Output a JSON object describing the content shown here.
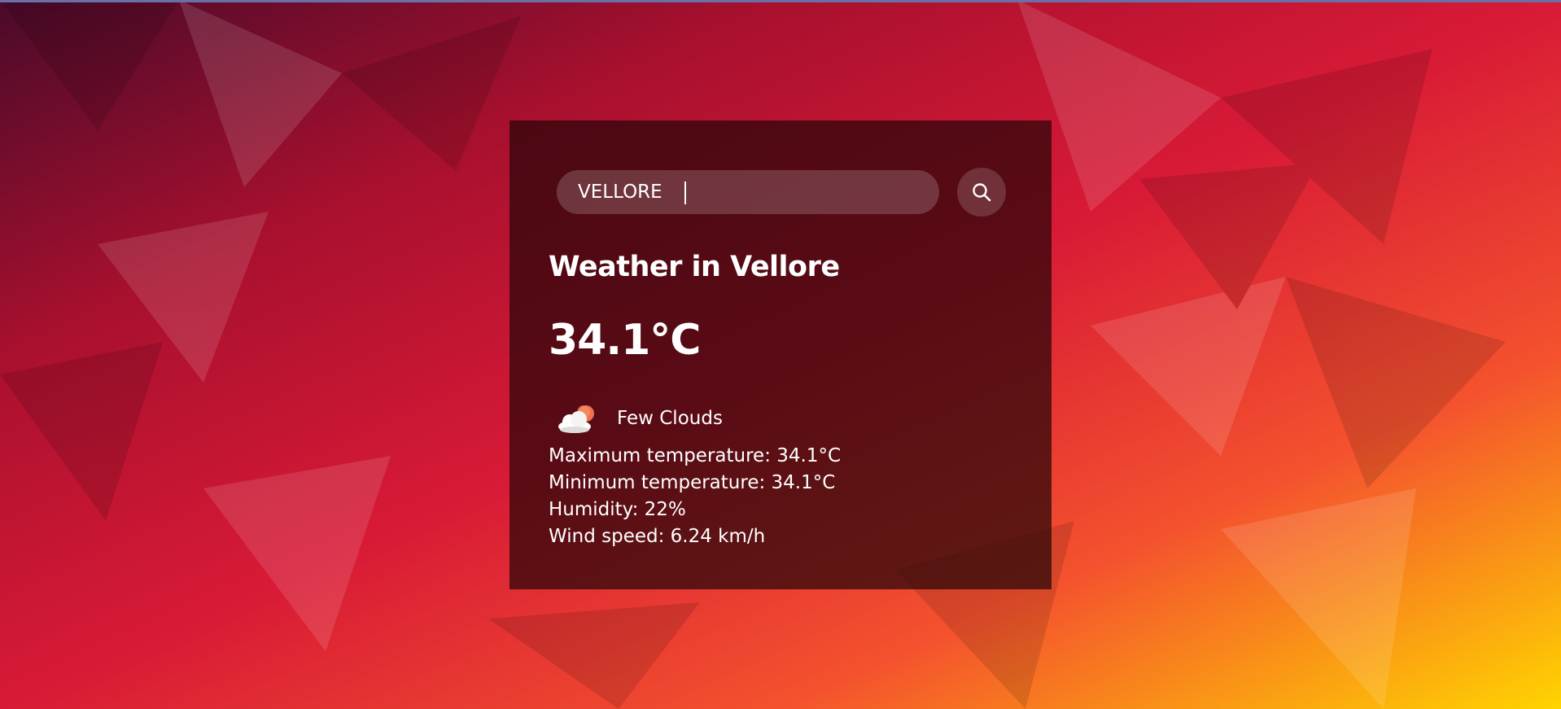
{
  "search": {
    "value": "VELLORE"
  },
  "weather": {
    "title": "Weather in Vellore",
    "temperature": "34.1°C",
    "condition": "Few Clouds",
    "details": {
      "max_temp": "Maximum temperature: 34.1°C",
      "min_temp": "Minimum temperature: 34.1°C",
      "humidity": "Humidity: 22%",
      "wind": "Wind speed: 6.24 km/h"
    }
  },
  "icons": {
    "search": "search-icon",
    "condition": "few-clouds-icon"
  },
  "colors": {
    "bg_top_left": "#4a0a2a",
    "bg_red": "#c8102e",
    "bg_orange": "#f26a2a",
    "bg_yellow": "#ffd400",
    "card": "#28060b",
    "sun": "#f07050"
  }
}
